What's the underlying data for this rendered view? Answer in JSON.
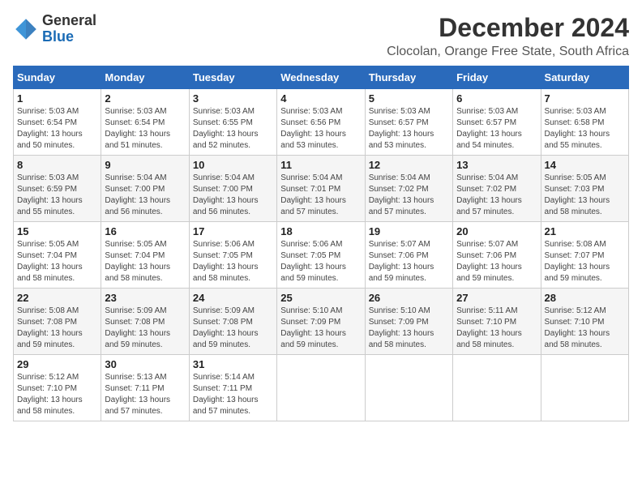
{
  "logo": {
    "line1": "General",
    "line2": "Blue"
  },
  "title": "December 2024",
  "subtitle": "Clocolan, Orange Free State, South Africa",
  "weekdays": [
    "Sunday",
    "Monday",
    "Tuesday",
    "Wednesday",
    "Thursday",
    "Friday",
    "Saturday"
  ],
  "weeks": [
    [
      {
        "day": "1",
        "sunrise": "5:03 AM",
        "sunset": "6:54 PM",
        "daylight": "13 hours and 50 minutes."
      },
      {
        "day": "2",
        "sunrise": "5:03 AM",
        "sunset": "6:54 PM",
        "daylight": "13 hours and 51 minutes."
      },
      {
        "day": "3",
        "sunrise": "5:03 AM",
        "sunset": "6:55 PM",
        "daylight": "13 hours and 52 minutes."
      },
      {
        "day": "4",
        "sunrise": "5:03 AM",
        "sunset": "6:56 PM",
        "daylight": "13 hours and 53 minutes."
      },
      {
        "day": "5",
        "sunrise": "5:03 AM",
        "sunset": "6:57 PM",
        "daylight": "13 hours and 53 minutes."
      },
      {
        "day": "6",
        "sunrise": "5:03 AM",
        "sunset": "6:57 PM",
        "daylight": "13 hours and 54 minutes."
      },
      {
        "day": "7",
        "sunrise": "5:03 AM",
        "sunset": "6:58 PM",
        "daylight": "13 hours and 55 minutes."
      }
    ],
    [
      {
        "day": "8",
        "sunrise": "5:03 AM",
        "sunset": "6:59 PM",
        "daylight": "13 hours and 55 minutes."
      },
      {
        "day": "9",
        "sunrise": "5:04 AM",
        "sunset": "7:00 PM",
        "daylight": "13 hours and 56 minutes."
      },
      {
        "day": "10",
        "sunrise": "5:04 AM",
        "sunset": "7:00 PM",
        "daylight": "13 hours and 56 minutes."
      },
      {
        "day": "11",
        "sunrise": "5:04 AM",
        "sunset": "7:01 PM",
        "daylight": "13 hours and 57 minutes."
      },
      {
        "day": "12",
        "sunrise": "5:04 AM",
        "sunset": "7:02 PM",
        "daylight": "13 hours and 57 minutes."
      },
      {
        "day": "13",
        "sunrise": "5:04 AM",
        "sunset": "7:02 PM",
        "daylight": "13 hours and 57 minutes."
      },
      {
        "day": "14",
        "sunrise": "5:05 AM",
        "sunset": "7:03 PM",
        "daylight": "13 hours and 58 minutes."
      }
    ],
    [
      {
        "day": "15",
        "sunrise": "5:05 AM",
        "sunset": "7:04 PM",
        "daylight": "13 hours and 58 minutes."
      },
      {
        "day": "16",
        "sunrise": "5:05 AM",
        "sunset": "7:04 PM",
        "daylight": "13 hours and 58 minutes."
      },
      {
        "day": "17",
        "sunrise": "5:06 AM",
        "sunset": "7:05 PM",
        "daylight": "13 hours and 58 minutes."
      },
      {
        "day": "18",
        "sunrise": "5:06 AM",
        "sunset": "7:05 PM",
        "daylight": "13 hours and 59 minutes."
      },
      {
        "day": "19",
        "sunrise": "5:07 AM",
        "sunset": "7:06 PM",
        "daylight": "13 hours and 59 minutes."
      },
      {
        "day": "20",
        "sunrise": "5:07 AM",
        "sunset": "7:06 PM",
        "daylight": "13 hours and 59 minutes."
      },
      {
        "day": "21",
        "sunrise": "5:08 AM",
        "sunset": "7:07 PM",
        "daylight": "13 hours and 59 minutes."
      }
    ],
    [
      {
        "day": "22",
        "sunrise": "5:08 AM",
        "sunset": "7:08 PM",
        "daylight": "13 hours and 59 minutes."
      },
      {
        "day": "23",
        "sunrise": "5:09 AM",
        "sunset": "7:08 PM",
        "daylight": "13 hours and 59 minutes."
      },
      {
        "day": "24",
        "sunrise": "5:09 AM",
        "sunset": "7:08 PM",
        "daylight": "13 hours and 59 minutes."
      },
      {
        "day": "25",
        "sunrise": "5:10 AM",
        "sunset": "7:09 PM",
        "daylight": "13 hours and 59 minutes."
      },
      {
        "day": "26",
        "sunrise": "5:10 AM",
        "sunset": "7:09 PM",
        "daylight": "13 hours and 58 minutes."
      },
      {
        "day": "27",
        "sunrise": "5:11 AM",
        "sunset": "7:10 PM",
        "daylight": "13 hours and 58 minutes."
      },
      {
        "day": "28",
        "sunrise": "5:12 AM",
        "sunset": "7:10 PM",
        "daylight": "13 hours and 58 minutes."
      }
    ],
    [
      {
        "day": "29",
        "sunrise": "5:12 AM",
        "sunset": "7:10 PM",
        "daylight": "13 hours and 58 minutes."
      },
      {
        "day": "30",
        "sunrise": "5:13 AM",
        "sunset": "7:11 PM",
        "daylight": "13 hours and 57 minutes."
      },
      {
        "day": "31",
        "sunrise": "5:14 AM",
        "sunset": "7:11 PM",
        "daylight": "13 hours and 57 minutes."
      },
      null,
      null,
      null,
      null
    ]
  ]
}
